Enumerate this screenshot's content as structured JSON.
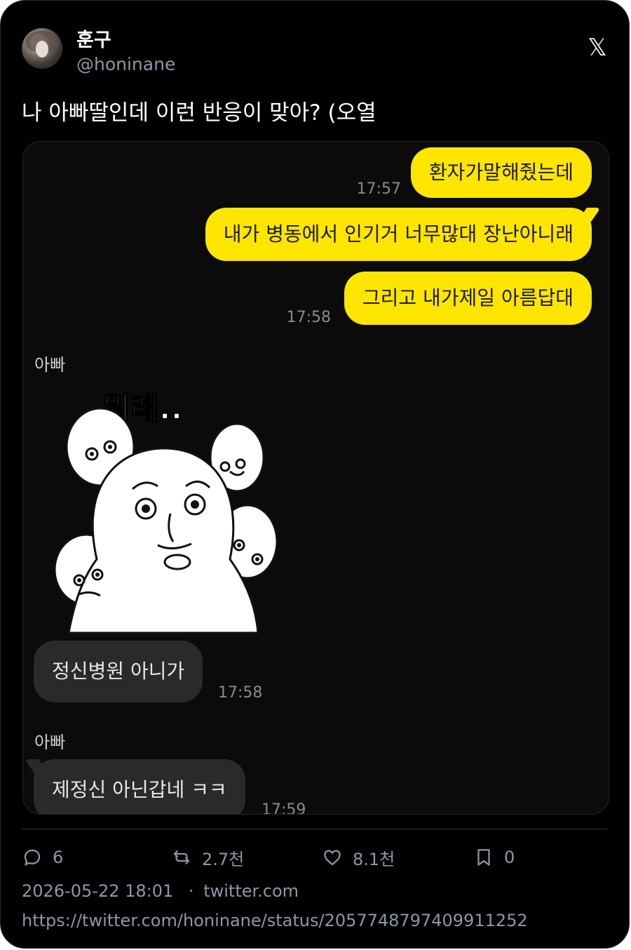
{
  "tweet": {
    "author_name": "훈구",
    "author_handle": "@honinane",
    "text": "나 아빠딸인데 이런 반응이 맞아? (오열",
    "date": "2026-05-22 18:01",
    "separator": "·",
    "source": "twitter.com",
    "url": "https://twitter.com/honinane/status/2057748797409911252",
    "stats": {
      "replies": "6",
      "retweets": "2.7천",
      "likes": "8.1천",
      "bookmarks": "0"
    }
  },
  "chat": {
    "messages_me": [
      {
        "text": "환자가말해줬는데",
        "time": "17:57"
      },
      {
        "text": "내가 병동에서 인기거 너무많대 장난아니래",
        "time": ""
      },
      {
        "text": "그리고 내가제일 아름답대",
        "time": "17:58"
      }
    ],
    "sender_1": "아빠",
    "sticker_caption": "뭐래..",
    "reply_1": {
      "text": "정신병원 아니가",
      "time": "17:58"
    },
    "sender_2": "아빠",
    "reply_2": {
      "text": "제정신 아닌갑네 ㅋㅋ",
      "time": "17:59"
    }
  },
  "colors": {
    "background": "#000000",
    "my_bubble": "#fee500",
    "other_bubble": "#2a2a2a",
    "muted_text": "#8b98a5"
  },
  "icons": [
    "x-logo-icon",
    "reply-icon",
    "retweet-icon",
    "like-icon",
    "bookmark-icon"
  ]
}
